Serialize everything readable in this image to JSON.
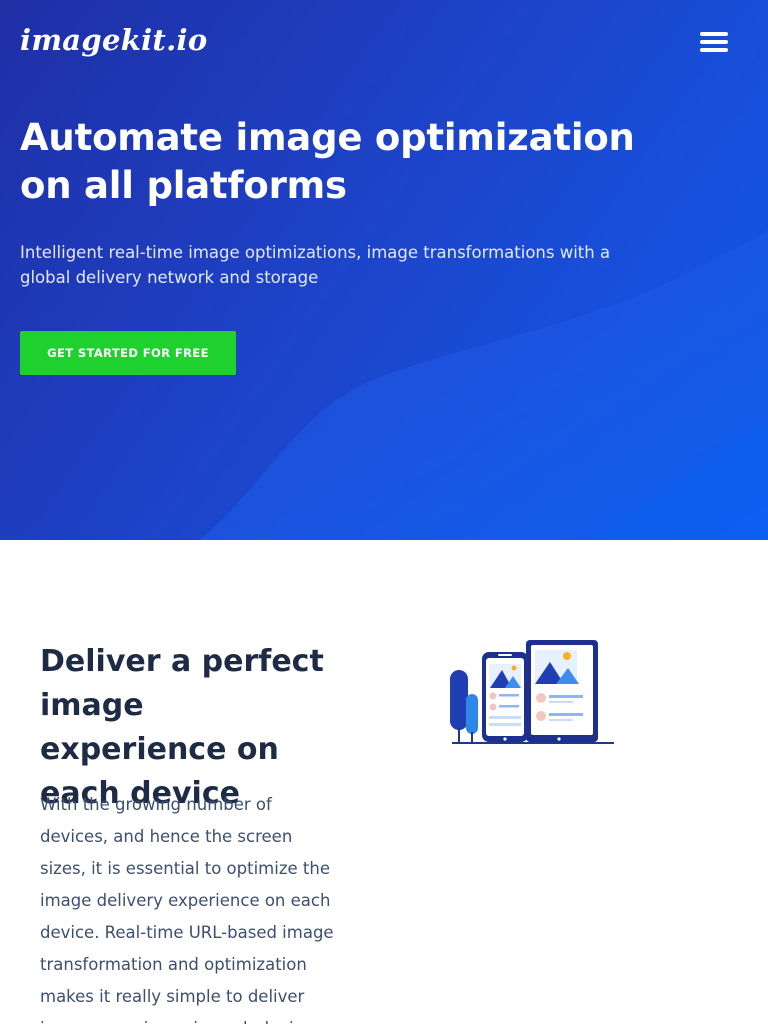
{
  "header": {
    "logo_text": "imagekit.io",
    "menu_icon": "hamburger-menu-icon"
  },
  "hero": {
    "title": "Automate image optimization on all platforms",
    "subtitle": "Intelligent real-time image optimizations, image transformations with a global delivery network and storage",
    "cta_label": "GET STARTED FOR FREE"
  },
  "feature": {
    "title": "Deliver a perfect image experience on each device",
    "body": "With the growing number of devices, and hence the screen sizes, it is essential to optimize the image delivery experience on each device. Real-time URL-based image transformation and optimization makes it really simple to deliver image experience in each device.",
    "illustration_icon": "devices-illustration-icon"
  },
  "colors": {
    "hero_gradient_start": "#1f2fa6",
    "hero_gradient_end": "#0f5be6",
    "cta_green": "#1fd12f",
    "heading_dark": "#1d2b45",
    "body_text": "#3d4f6e"
  }
}
